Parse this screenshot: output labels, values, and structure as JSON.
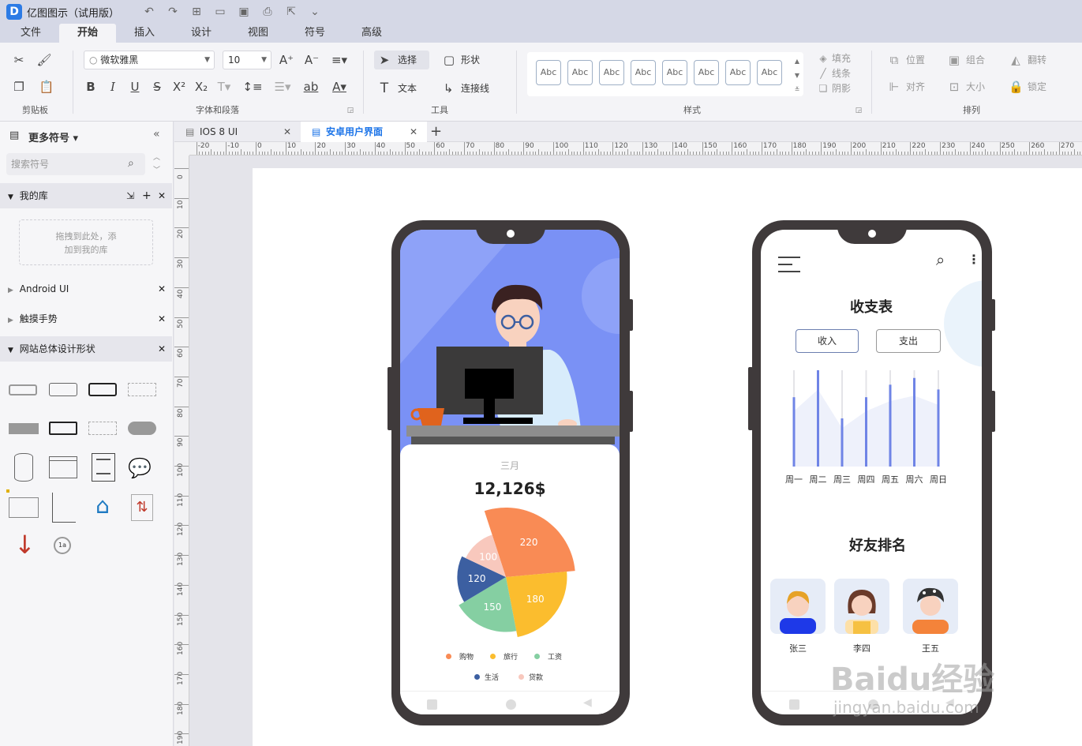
{
  "app": {
    "title": "亿图图示（试用版）",
    "logo_letter": "D"
  },
  "ribbon_tabs": [
    "文件",
    "开始",
    "插入",
    "设计",
    "视图",
    "符号",
    "高级"
  ],
  "active_tab": "开始",
  "ribbon": {
    "font_name": "微软雅黑",
    "font_size": "10",
    "select_label": "选择",
    "shape_label": "形状",
    "text_label": "文本",
    "connector_label": "连接线",
    "style_sample": "Abc",
    "fill_label": "填充",
    "line_label": "线条",
    "shadow_label": "阴影",
    "position_label": "位置",
    "group_label": "组合",
    "flip_label": "翻转",
    "align_label": "对齐",
    "size_label": "大小",
    "lock_label": "锁定",
    "groups": {
      "clipboard": "剪贴板",
      "font_para": "字体和段落",
      "tools": "工具",
      "styles": "样式",
      "arrange": "排列"
    }
  },
  "sidebar": {
    "header": "更多符号",
    "search_placeholder": "搜索符号",
    "my_library": "我的库",
    "drop_hint_1": "拖拽到此处，添",
    "drop_hint_2": "加到我的库",
    "libraries": [
      "Android UI",
      "触摸手势",
      "网站总体设计形状"
    ]
  },
  "doc_tabs": [
    {
      "label": "IOS 8 UI",
      "active": false
    },
    {
      "label": "安卓用户界面",
      "active": true
    }
  ],
  "ruler_h": [
    "-20",
    "-10",
    "0",
    "10",
    "20",
    "30",
    "40",
    "50",
    "60",
    "70",
    "80",
    "90",
    "100",
    "110",
    "120",
    "130",
    "140",
    "150",
    "160",
    "170",
    "180",
    "190",
    "200",
    "210",
    "220",
    "230",
    "240",
    "250",
    "260",
    "270"
  ],
  "ruler_v": [
    "0",
    "10",
    "20",
    "30",
    "40",
    "50",
    "60",
    "70",
    "80",
    "90",
    "100",
    "110",
    "120",
    "130",
    "140",
    "150",
    "160",
    "170",
    "180",
    "190"
  ],
  "phone1": {
    "month": "三月",
    "amount": "12,126$",
    "legend": [
      {
        "label": "购物",
        "color": "#f98b55"
      },
      {
        "label": "旅行",
        "color": "#fbbd2e"
      },
      {
        "label": "工资",
        "color": "#85cfa2"
      },
      {
        "label": "生活",
        "color": "#3c5fa1"
      },
      {
        "label": "贷款",
        "color": "#f8c8bd"
      }
    ]
  },
  "chart_data": [
    {
      "type": "pie",
      "title": "",
      "categories": [
        "购物",
        "旅行",
        "工资",
        "生活",
        "贷款"
      ],
      "values": [
        220,
        180,
        150,
        120,
        100
      ],
      "data_labels": [
        "220",
        "180",
        "150",
        "120",
        "100"
      ],
      "colors": [
        "#f98b55",
        "#fbbd2e",
        "#85cfa2",
        "#3c5fa1",
        "#f8c8bd"
      ],
      "legend": "bottom"
    },
    {
      "type": "bar",
      "title": "",
      "categories": [
        "周一",
        "周二",
        "周三",
        "周四",
        "周五",
        "周六",
        "周日"
      ],
      "values": [
        72,
        100,
        50,
        72,
        85,
        92,
        80
      ],
      "ylim": [
        0,
        100
      ],
      "series_color": "#6f84e6"
    }
  ],
  "phone2": {
    "title": "收支表",
    "tab_income": "收入",
    "tab_expense": "支出",
    "friends_title": "好友排名",
    "friends": [
      "张三",
      "李四",
      "王五"
    ]
  },
  "watermark": {
    "text": "Baidu经验",
    "url": "jingyan.baidu.com"
  }
}
